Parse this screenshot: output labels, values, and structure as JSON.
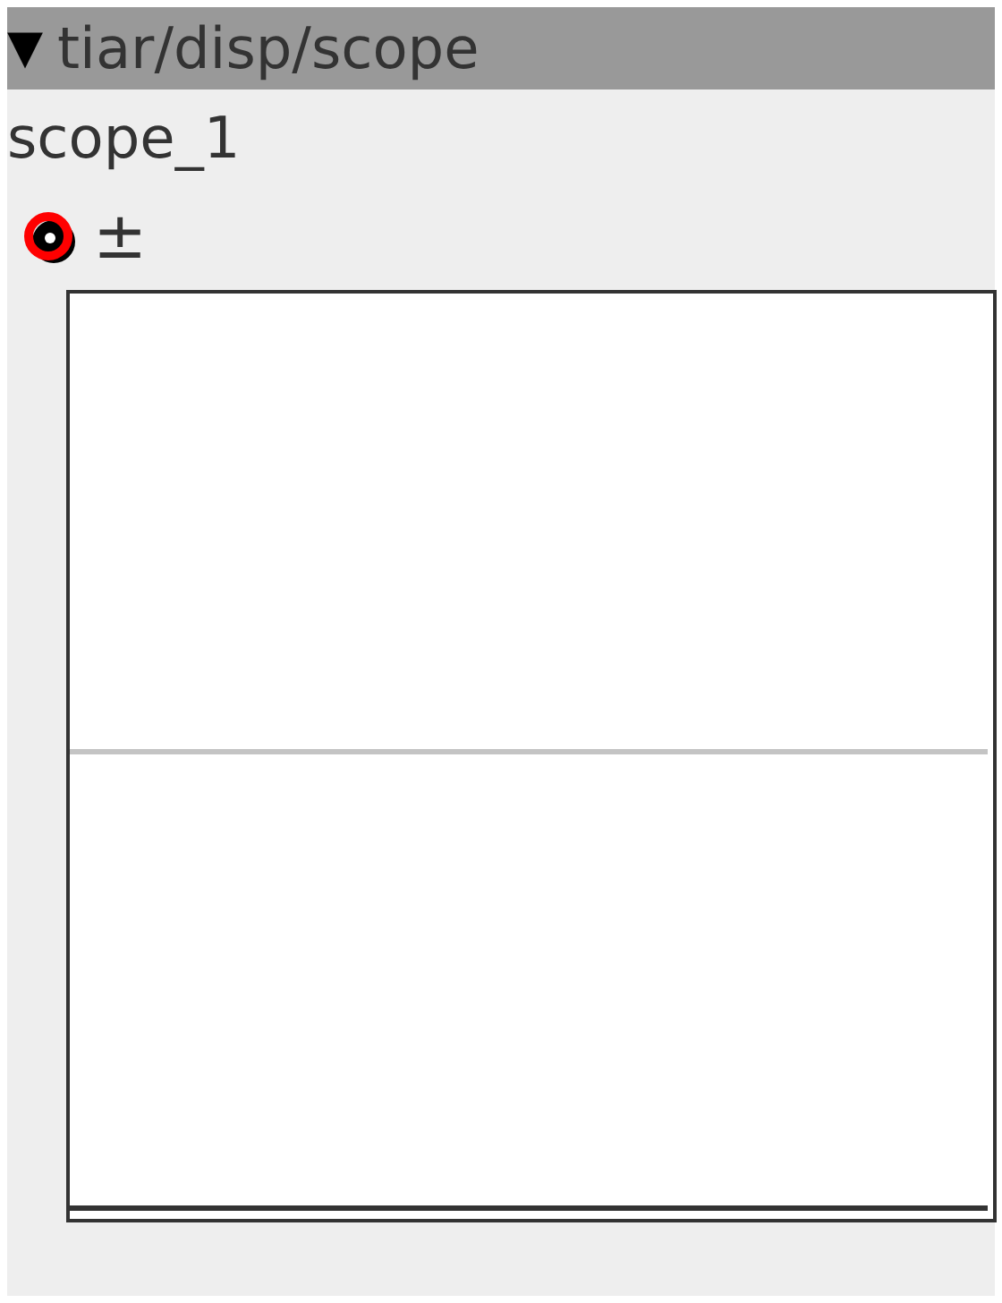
{
  "panel": {
    "toggle": "▼",
    "title": "tiar/disp/scope"
  },
  "scope": {
    "name": "scope_1",
    "toolbar": [
      {
        "kind": "ring"
      },
      {
        "kind": "text",
        "label": "±"
      }
    ]
  }
}
